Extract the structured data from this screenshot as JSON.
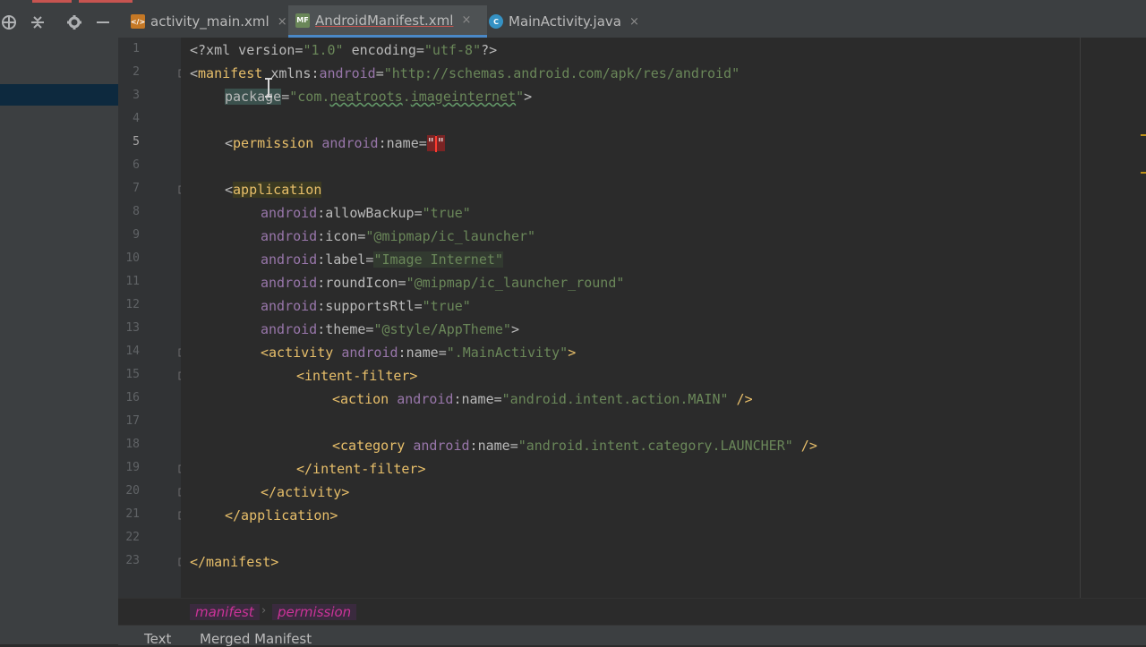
{
  "tabs": [
    {
      "label": "activity_main.xml",
      "icon": "xml-layout-icon",
      "active": false
    },
    {
      "label": "AndroidManifest.xml",
      "icon": "manifest-file-icon",
      "active": true
    },
    {
      "label": "MainActivity.java",
      "icon": "java-class-icon",
      "active": false
    }
  ],
  "close_glyph": "×",
  "gutter": {
    "line_numbers": [
      "1",
      "2",
      "3",
      "4",
      "5",
      "6",
      "7",
      "8",
      "9",
      "10",
      "11",
      "12",
      "13",
      "14",
      "15",
      "16",
      "17",
      "18",
      "19",
      "20",
      "21",
      "22",
      "23"
    ],
    "current_line": "5"
  },
  "code": {
    "l1": {
      "p1": "<?xml version=",
      "v1": "\"1.0\"",
      "p2": " encoding=",
      "v2": "\"utf-8\"",
      "p3": "?>"
    },
    "l2": {
      "lt": "<",
      "tag": "manifest",
      "sp": " ",
      "attr": "xmlns",
      "colon": ":",
      "ns": "android",
      "eq": "=",
      "val": "\"http://schemas.android.com/apk/res/android\""
    },
    "l3": {
      "attr": "package",
      "eq": "=",
      "q1": "\"",
      "v1": "com.",
      "v2": "neatroots",
      "v3": ".",
      "v4": "imageinternet",
      "q2": "\"",
      "end": ">"
    },
    "l5": {
      "lt": "<",
      "tag": "permission",
      "sp": " ",
      "ns": "android",
      "colon": ":",
      "attr": "name",
      "eq": "=",
      "q1": "\"",
      "q2": "\""
    },
    "l7": {
      "lt": "<",
      "tag": "application"
    },
    "l8": {
      "ns": "android",
      "colon": ":",
      "attr": "allowBackup",
      "eq": "=",
      "val": "\"true\""
    },
    "l9": {
      "ns": "android",
      "colon": ":",
      "attr": "icon",
      "eq": "=",
      "val": "\"@mipmap/ic_launcher\""
    },
    "l10": {
      "ns": "android",
      "colon": ":",
      "attr": "label",
      "eq": "=",
      "val": "\"Image Internet\""
    },
    "l11": {
      "ns": "android",
      "colon": ":",
      "attr": "roundIcon",
      "eq": "=",
      "val": "\"@mipmap/ic_launcher_round\""
    },
    "l12": {
      "ns": "android",
      "colon": ":",
      "attr": "supportsRtl",
      "eq": "=",
      "val": "\"true\""
    },
    "l13": {
      "ns": "android",
      "colon": ":",
      "attr": "theme",
      "eq": "=",
      "val": "\"@style/AppTheme\"",
      "end": ">"
    },
    "l14": {
      "open": "<activity ",
      "ns": "android",
      "colon": ":",
      "attr": "name",
      "eq": "=",
      "val": "\".MainActivity\"",
      "end": ">"
    },
    "l15": {
      "text": "<intent-filter>"
    },
    "l16": {
      "open": "<action ",
      "ns": "android",
      "colon": ":",
      "attr": "name",
      "eq": "=",
      "val": "\"android.intent.action.MAIN\"",
      "end": " />"
    },
    "l18": {
      "open": "<category ",
      "ns": "android",
      "colon": ":",
      "attr": "name",
      "eq": "=",
      "val": "\"android.intent.category.LAUNCHER\"",
      "end": " />"
    },
    "l19": {
      "text": "</intent-filter>"
    },
    "l20": {
      "text": "</activity>"
    },
    "l21": {
      "text": "</application>"
    },
    "l23": {
      "text": "</manifest>"
    }
  },
  "breadcrumb": {
    "items": [
      "manifest",
      "permission"
    ],
    "separator": "›"
  },
  "bottom_tabs": [
    "Text",
    "Merged Manifest"
  ],
  "colors": {
    "tag": "#e8bf6a",
    "namespace": "#9876aa",
    "value": "#6a8759",
    "accent": "#4a88c7",
    "breadcrumb": "#cc3399"
  }
}
